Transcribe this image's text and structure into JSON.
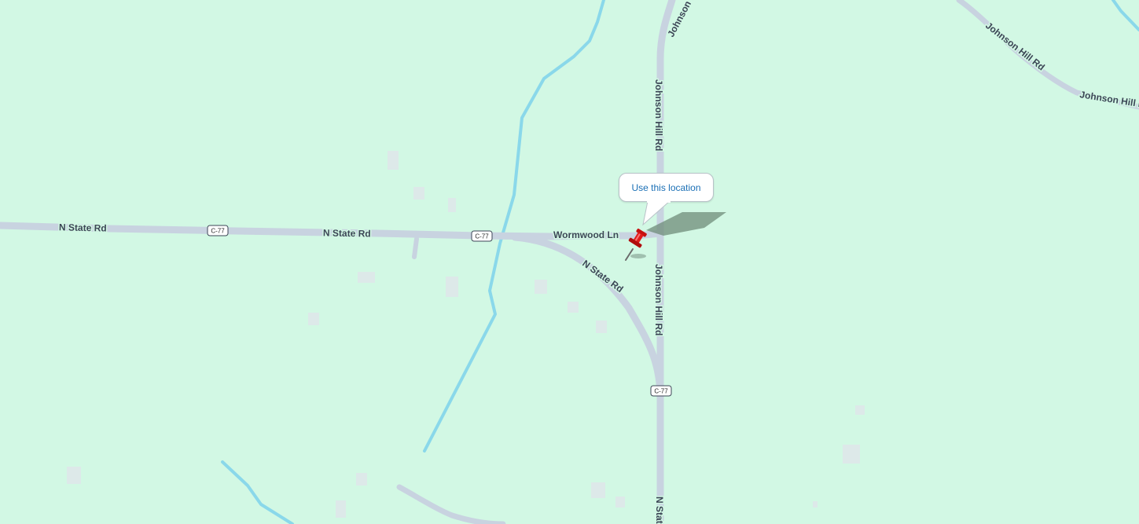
{
  "map": {
    "colors": {
      "land": "#d2f8e4",
      "road": "#c8d3e0",
      "water": "#8ad8ea",
      "label_text": "#3c4656",
      "pin": "#e01b1b",
      "link": "#1a6fb5"
    },
    "road_labels": {
      "n_state_rd_west": "N State Rd",
      "n_state_rd_mid": "N State Rd",
      "n_state_rd_curve": "N State Rd",
      "n_state_rd_south": "N State Rd",
      "wormwood_ln": "Wormwood Ln",
      "johnson_hill_rd_top": "Johnson Hill Rd",
      "johnson_hill_rd_north": "Johnson Hill Rd",
      "johnson_hill_rd_south": "Johnson Hill Rd",
      "johnson_hill_rd_ne": "Johnson Hill Rd",
      "johnson_hill_rd_east": "Johnson Hill Rd"
    },
    "route_shields": [
      "C-77",
      "C-77",
      "C-77"
    ],
    "marker": {
      "icon": "pushpin-icon",
      "popup_label": "Use this location"
    }
  }
}
